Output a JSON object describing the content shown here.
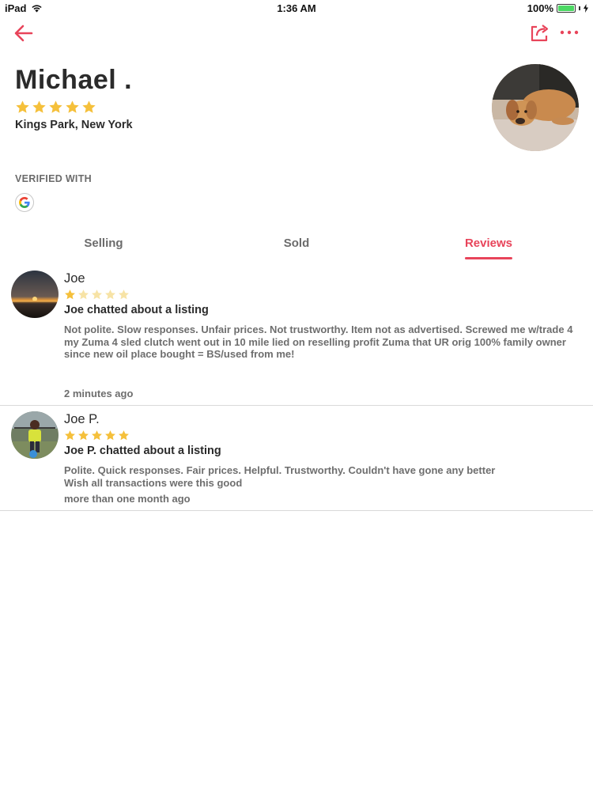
{
  "status_bar": {
    "device": "iPad",
    "time": "1:36 AM",
    "battery": "100%",
    "battery_level": 1.0
  },
  "nav": {
    "back_icon": "arrow-left-icon",
    "share_icon": "share-icon",
    "more_icon": "more-dots-icon"
  },
  "profile": {
    "name": "Michael .",
    "rating": 5,
    "location": "Kings Park, New York",
    "verified_label": "VERIFIED WITH",
    "verified_provider": "G"
  },
  "tabs": [
    {
      "label": "Selling",
      "active": false
    },
    {
      "label": "Sold",
      "active": false
    },
    {
      "label": "Reviews",
      "active": true
    }
  ],
  "reviews": [
    {
      "name": "Joe",
      "rating": 1,
      "headline": "Joe chatted about a listing",
      "body": "Not polite. Slow responses. Unfair prices. Not trustworthy. Item not as advertised. Screwed me w/trade 4 my Zuma 4 sled clutch went out in 10 mile lied on reselling profit Zuma that UR orig 100% family owner since new oil place bought = BS/used from me!",
      "time": "2 minutes ago"
    },
    {
      "name": "Joe P.",
      "rating": 5,
      "headline": "Joe P. chatted about a listing",
      "body": "Polite. Quick responses. Fair prices. Helpful. Trustworthy. Couldn't have gone any better\nWish all transactions were this good",
      "time": "more than one month ago"
    }
  ],
  "colors": {
    "accent": "#e8445a",
    "star": "#f5c03b",
    "star_empty": "#f7e3a6"
  }
}
